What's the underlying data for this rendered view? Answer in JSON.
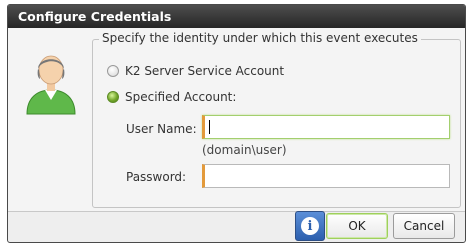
{
  "dialog": {
    "title": "Configure Credentials",
    "group_legend": "Specify the identity under which this event executes",
    "options": [
      {
        "label": "K2 Server Service Account",
        "selected": false
      },
      {
        "label": "Specified Account:",
        "selected": true
      }
    ],
    "username": {
      "label": "User Name:",
      "value": "",
      "hint": "(domain\\user)"
    },
    "password": {
      "label": "Password:",
      "value": ""
    },
    "buttons": {
      "info": "i",
      "ok": "OK",
      "cancel": "Cancel"
    }
  },
  "icons": [
    "user-avatar-icon",
    "info-icon",
    "radio-icon"
  ],
  "colors": {
    "titlebar": "#333333",
    "radio_selected": "#74a82c",
    "required_marker": "#e39a3b",
    "info_button": "#2c5fae"
  }
}
